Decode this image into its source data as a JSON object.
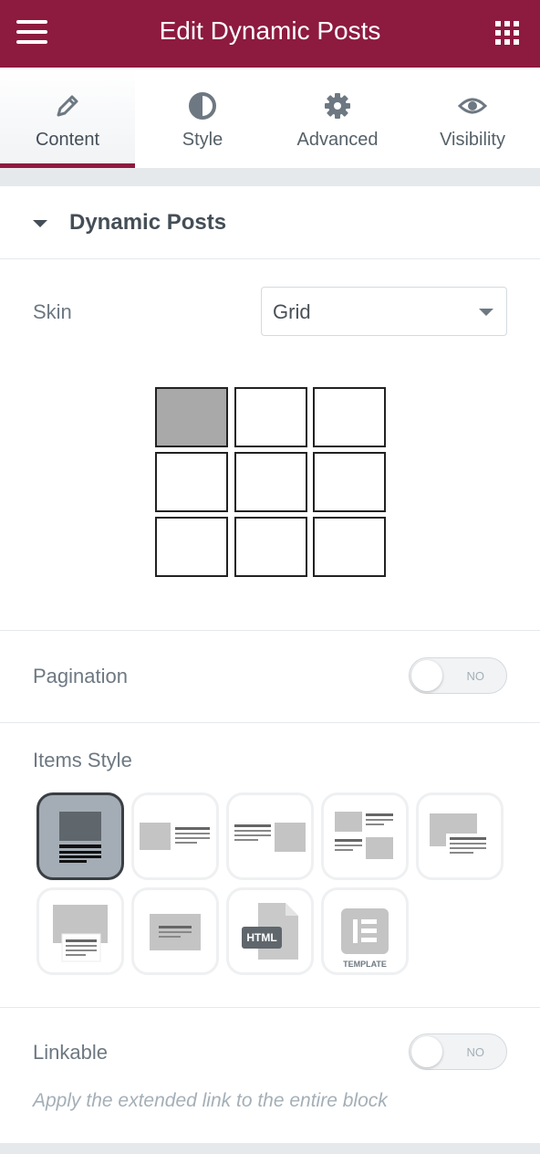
{
  "header": {
    "title": "Edit Dynamic Posts",
    "menu_icon": "hamburger-menu-icon",
    "apps_icon": "apps-grid-icon",
    "background": "#8d1a3f"
  },
  "tabs": [
    {
      "label": "Content",
      "icon": "pencil-icon",
      "active": true
    },
    {
      "label": "Style",
      "icon": "half-circle-icon",
      "active": false
    },
    {
      "label": "Advanced",
      "icon": "gear-icon",
      "active": false
    },
    {
      "label": "Visibility",
      "icon": "eye-icon",
      "active": false
    }
  ],
  "section": {
    "title": "Dynamic Posts",
    "expanded": true
  },
  "skin": {
    "label": "Skin",
    "value": "Grid"
  },
  "pagination": {
    "label": "Pagination",
    "state": "NO"
  },
  "items_style": {
    "label": "Items Style",
    "selected_index": 0,
    "options": [
      {
        "icon": "image-top-text-below-icon"
      },
      {
        "icon": "image-left-text-right-icon"
      },
      {
        "icon": "text-left-image-right-icon"
      },
      {
        "icon": "alternate-zigzag-icon"
      },
      {
        "icon": "overlap-text-icon"
      },
      {
        "icon": "image-with-card-below-icon"
      },
      {
        "icon": "text-overlay-icon"
      },
      {
        "icon": "html-file-icon",
        "text": "HTML"
      },
      {
        "icon": "elementor-template-icon",
        "text": "TEMPLATE"
      }
    ]
  },
  "linkable": {
    "label": "Linkable",
    "state": "NO",
    "description": "Apply the extended link to the entire block"
  }
}
